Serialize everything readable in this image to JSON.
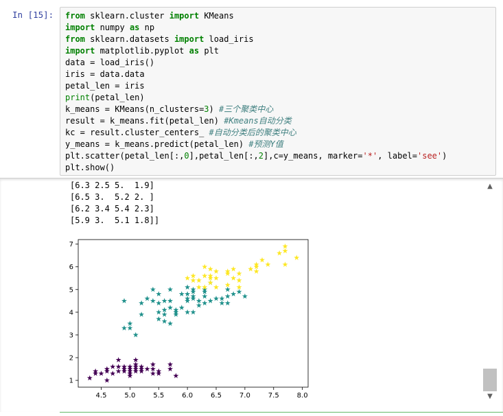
{
  "cell": {
    "prompt": "In  [15]:",
    "code": [
      "from sklearn.cluster import KMeans",
      "import numpy as np",
      "from sklearn.datasets import load_iris",
      "import matplotlib.pyplot as plt",
      "data = load_iris()",
      "iris = data.data",
      "petal_len = iris",
      "print(petal_len)",
      "k_means = KMeans(n_clusters=3) #三个聚类中心",
      "result = k_means.fit(petal_len) #Kmeans自动分类",
      "kc = result.cluster_centers_ #自动分类后的聚类中心",
      "y_means = k_means.predict(petal_len) #预测Y值",
      "plt.scatter(petal_len[:,0],petal_len[:,2],c=y_means, marker='*', label='see')",
      "plt.show()"
    ]
  },
  "output": {
    "lines": [
      "[6.3 2.5 5.  1.9]",
      "[6.5 3.  5.2 2. ]",
      "[6.2 3.4 5.4 2.3]",
      "[5.9 3.  5.1 1.8]]"
    ]
  },
  "scrollbar": {
    "up_icon": "▲",
    "down_icon": "▼"
  },
  "chart_data": {
    "type": "scatter",
    "marker": "*",
    "xlim": [
      4.1,
      8.1
    ],
    "ylim": [
      0.7,
      7.2
    ],
    "xticks": [
      4.5,
      5.0,
      5.5,
      6.0,
      6.5,
      7.0,
      7.5,
      8.0
    ],
    "xtick_labels": [
      "4.5",
      "5.0",
      "5.5",
      "6.0",
      "6.5",
      "7.0",
      "7.5",
      "8.0"
    ],
    "yticks": [
      1,
      2,
      3,
      4,
      5,
      6,
      7
    ],
    "ytick_labels": [
      "1",
      "2",
      "3",
      "4",
      "5",
      "6",
      "7"
    ],
    "colors": {
      "0": "#440154",
      "1": "#21918c",
      "2": "#fde725"
    },
    "series": [
      {
        "cluster": 0,
        "points": [
          [
            4.3,
            1.1
          ],
          [
            4.4,
            1.4
          ],
          [
            4.4,
            1.3
          ],
          [
            4.5,
            1.3
          ],
          [
            4.6,
            1.5
          ],
          [
            4.6,
            1.0
          ],
          [
            4.6,
            1.4
          ],
          [
            4.7,
            1.3
          ],
          [
            4.7,
            1.6
          ],
          [
            4.8,
            1.6
          ],
          [
            4.8,
            1.4
          ],
          [
            4.8,
            1.9
          ],
          [
            4.9,
            1.4
          ],
          [
            4.9,
            1.5
          ],
          [
            5.0,
            1.4
          ],
          [
            5.0,
            1.2
          ],
          [
            5.0,
            1.6
          ],
          [
            5.0,
            1.5
          ],
          [
            5.0,
            1.3
          ],
          [
            5.1,
            1.4
          ],
          [
            5.1,
            1.5
          ],
          [
            5.1,
            1.7
          ],
          [
            5.1,
            1.9
          ],
          [
            5.1,
            1.6
          ],
          [
            5.2,
            1.5
          ],
          [
            5.2,
            1.4
          ],
          [
            5.3,
            1.5
          ],
          [
            5.4,
            1.7
          ],
          [
            5.4,
            1.5
          ],
          [
            5.4,
            1.3
          ],
          [
            5.5,
            1.4
          ],
          [
            5.5,
            1.3
          ],
          [
            5.7,
            1.5
          ],
          [
            5.7,
            1.7
          ],
          [
            5.8,
            1.2
          ],
          [
            5.2,
            1.6
          ],
          [
            4.9,
            1.6
          ]
        ]
      },
      {
        "cluster": 1,
        "points": [
          [
            4.9,
            3.3
          ],
          [
            4.9,
            4.5
          ],
          [
            5.0,
            3.5
          ],
          [
            5.0,
            3.3
          ],
          [
            5.1,
            3.0
          ],
          [
            5.2,
            3.9
          ],
          [
            5.4,
            4.5
          ],
          [
            5.5,
            4.0
          ],
          [
            5.5,
            3.7
          ],
          [
            5.5,
            4.4
          ],
          [
            5.6,
            3.9
          ],
          [
            5.6,
            4.1
          ],
          [
            5.6,
            4.5
          ],
          [
            5.6,
            3.6
          ],
          [
            5.7,
            4.5
          ],
          [
            5.7,
            4.2
          ],
          [
            5.7,
            3.5
          ],
          [
            5.7,
            5.0
          ],
          [
            5.8,
            4.1
          ],
          [
            5.8,
            4.0
          ],
          [
            5.8,
            3.9
          ],
          [
            5.9,
            4.8
          ],
          [
            5.9,
            4.2
          ],
          [
            6.0,
            4.5
          ],
          [
            6.0,
            4.0
          ],
          [
            6.0,
            5.1
          ],
          [
            6.0,
            4.8
          ],
          [
            6.1,
            4.7
          ],
          [
            6.1,
            4.0
          ],
          [
            6.1,
            4.6
          ],
          [
            6.2,
            4.5
          ],
          [
            6.2,
            4.3
          ],
          [
            6.3,
            4.9
          ],
          [
            6.3,
            4.4
          ],
          [
            6.3,
            5.0
          ],
          [
            6.4,
            4.5
          ],
          [
            6.4,
            5.3
          ],
          [
            6.5,
            4.6
          ],
          [
            6.6,
            4.6
          ],
          [
            6.6,
            4.4
          ],
          [
            6.7,
            4.7
          ],
          [
            6.7,
            4.4
          ],
          [
            6.7,
            5.0
          ],
          [
            6.8,
            4.8
          ],
          [
            6.9,
            4.9
          ],
          [
            7.0,
            4.7
          ],
          [
            6.3,
            4.7
          ],
          [
            5.4,
            5.0
          ],
          [
            6.1,
            4.9
          ],
          [
            5.5,
            4.8
          ],
          [
            6.1,
            5.0
          ],
          [
            5.3,
            4.6
          ],
          [
            6.0,
            4.6
          ],
          [
            5.2,
            4.4
          ]
        ]
      },
      {
        "cluster": 2,
        "points": [
          [
            6.0,
            5.5
          ],
          [
            6.1,
            5.6
          ],
          [
            6.2,
            5.4
          ],
          [
            6.3,
            6.0
          ],
          [
            6.3,
            5.6
          ],
          [
            6.3,
            5.1
          ],
          [
            6.4,
            5.5
          ],
          [
            6.4,
            5.6
          ],
          [
            6.4,
            5.3
          ],
          [
            6.5,
            5.8
          ],
          [
            6.5,
            5.1
          ],
          [
            6.5,
            5.5
          ],
          [
            6.7,
            5.7
          ],
          [
            6.7,
            5.8
          ],
          [
            6.8,
            5.5
          ],
          [
            6.8,
            5.9
          ],
          [
            6.9,
            5.4
          ],
          [
            6.9,
            5.1
          ],
          [
            6.9,
            5.7
          ],
          [
            7.1,
            5.9
          ],
          [
            7.2,
            6.1
          ],
          [
            7.2,
            5.8
          ],
          [
            7.3,
            6.3
          ],
          [
            7.4,
            6.1
          ],
          [
            7.6,
            6.6
          ],
          [
            7.7,
            6.7
          ],
          [
            7.7,
            6.9
          ],
          [
            7.7,
            6.1
          ],
          [
            7.9,
            6.4
          ],
          [
            6.2,
            5.1
          ],
          [
            7.2,
            6.0
          ],
          [
            6.7,
            5.2
          ],
          [
            6.4,
            5.9
          ],
          [
            6.1,
            5.4
          ]
        ]
      }
    ]
  }
}
